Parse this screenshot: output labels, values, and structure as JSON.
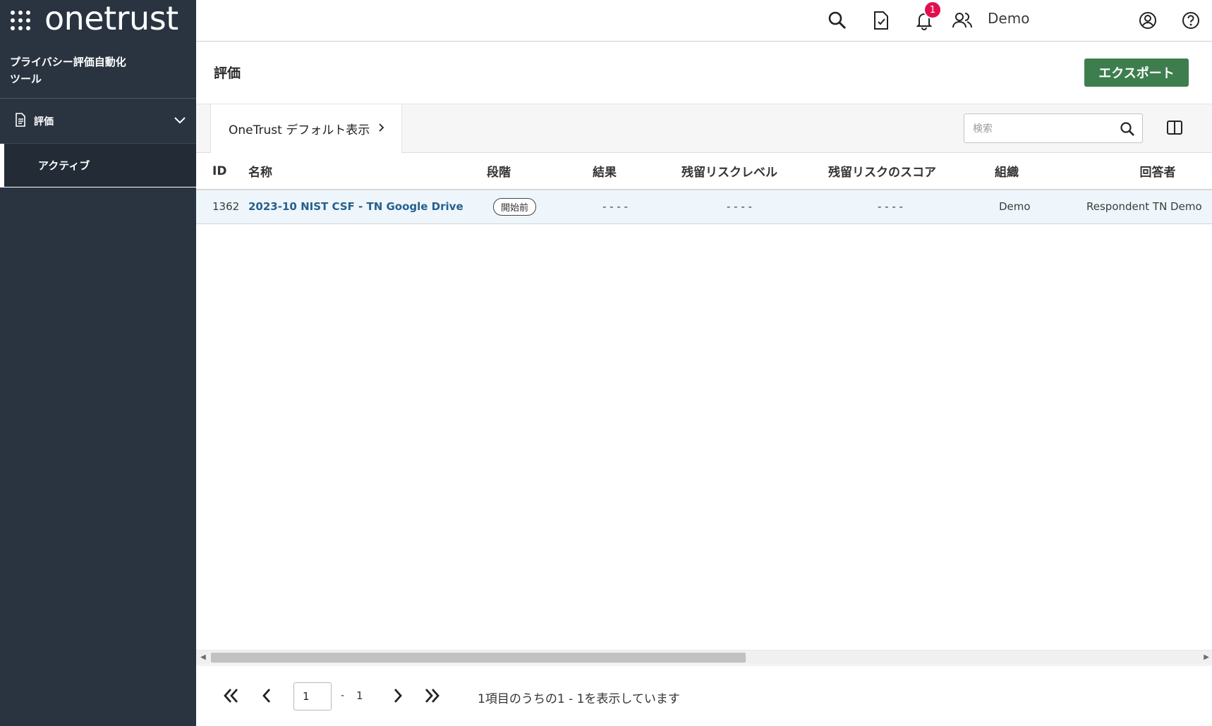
{
  "brand": {
    "logo_text": "onetrust"
  },
  "sidebar": {
    "module_title": "プライバシー評価自動化\nツール",
    "group_label": "評価",
    "sub_item": "アクティブ"
  },
  "topbar": {
    "notification_count": "1",
    "user_name": "Demo"
  },
  "page": {
    "title": "評価",
    "export_label": "エクスポート"
  },
  "filter": {
    "view_label": "OneTrust デフォルト表示",
    "search_placeholder": "検索"
  },
  "table": {
    "headers": {
      "id": "ID",
      "name": "名称",
      "stage": "段階",
      "result": "結果",
      "residual_level": "残留リスクレベル",
      "residual_score": "残留リスクのスコア",
      "org": "組織",
      "respondent": "回答者"
    },
    "rows": [
      {
        "id": "1362",
        "name": "2023-10 NIST CSF - TN Google Drive",
        "stage": "開始前",
        "result": "- - - -",
        "residual_level": "- - - -",
        "residual_score": "- - - -",
        "org": "Demo",
        "respondent": "Respondent TN Demo"
      }
    ]
  },
  "pagination": {
    "current_page": "1",
    "separator": "-",
    "total_pages": "1",
    "summary": "1項目のうちの1 - 1を表示しています"
  },
  "colors": {
    "sidebar_bg": "#2a3441",
    "export_green": "#3e7e4e",
    "link_blue": "#26608e",
    "badge_red": "#e0104f",
    "row_highlight": "#eef6fb"
  }
}
